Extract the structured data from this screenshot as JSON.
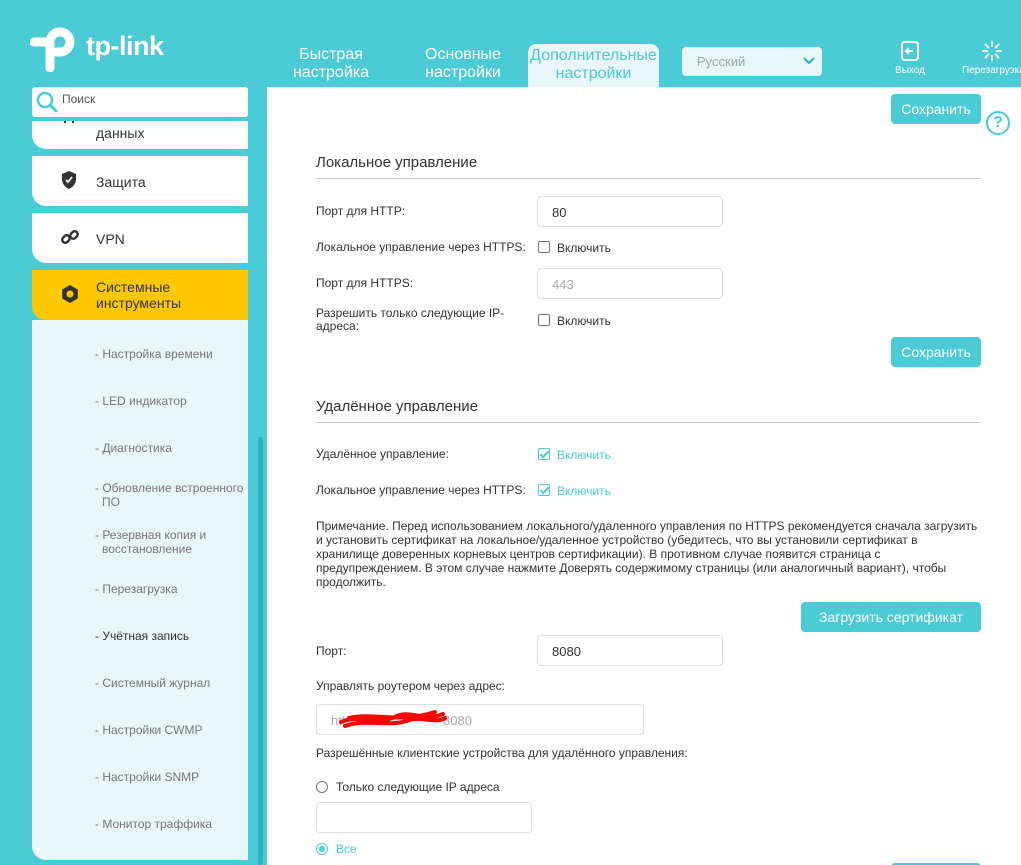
{
  "brand": {
    "name": "tp-link"
  },
  "tabs": [
    {
      "label_line1": "Быстрая",
      "label_line2": "настройка"
    },
    {
      "label_line1": "Основные",
      "label_line2": "настройки"
    },
    {
      "label_line1": "Дополнительные",
      "label_line2": "настройки"
    }
  ],
  "language": {
    "selected": "Русский"
  },
  "header_buttons": {
    "logout": "Выход",
    "reboot": "Перезагрузка"
  },
  "search": {
    "placeholder": "Поиск"
  },
  "sidebar": {
    "items": [
      {
        "label": "данных",
        "icon": "sort-arrows-icon"
      },
      {
        "label": "Защита",
        "icon": "shield-icon"
      },
      {
        "label": "VPN",
        "icon": "link-icon"
      },
      {
        "label_line1": "Системные",
        "label_line2": "инструменты",
        "icon": "gear-icon",
        "active": true
      }
    ],
    "subitems": [
      {
        "label": "- Настройка времени"
      },
      {
        "label": "- LED индикатор"
      },
      {
        "label": "- Диагностика"
      },
      {
        "label_line1": "- Обновление встроенного",
        "label_line2": "ПО"
      },
      {
        "label_line1": "- Резервная копия и",
        "label_line2": "восстановление"
      },
      {
        "label": "- Перезагрузка"
      },
      {
        "label": "- Учётная запись",
        "current": true
      },
      {
        "label": "- Системный журнал"
      },
      {
        "label": "- Настройки CWMP"
      },
      {
        "label": "- Настройки SNMP"
      },
      {
        "label": "- Монитор траффика"
      }
    ]
  },
  "main": {
    "save_label": "Сохранить",
    "local": {
      "title": "Локальное управление",
      "http_port_label": "Порт для HTTP:",
      "http_port_value": "80",
      "https_label": "Локальное управление через HTTPS:",
      "https_enable": "Включить",
      "https_enabled": false,
      "https_port_label": "Порт для HTTPS:",
      "https_port_value": "443",
      "allow_ip_label_line1": "Разрешить только следующие IP-",
      "allow_ip_label_line2": "адреса:",
      "allow_ip_enable": "Включить",
      "allow_ip_enabled": false
    },
    "remote": {
      "title": "Удалённое управление",
      "remote_label": "Удалённое управление:",
      "remote_enable": "Включить",
      "remote_enabled": true,
      "https_label": "Локальное управление через HTTPS:",
      "https_enable": "Включить",
      "https_enabled": true,
      "note": "Примечание. Перед использованием локального/удаленного управления по HTTPS рекомендуется сначала загрузить и установить сертификат на локальное/удаленное устройство (убедитесь, что вы установили сертификат в хранилище доверенных корневых центров сертификации). В противном случае появится страница с предупреждением. В этом случае нажмите Доверять содержимому страницы (или аналогичный вариант), чтобы продолжить.",
      "upload_cert": "Загрузить сертификат",
      "port_label": "Порт:",
      "port_value": "8080",
      "address_label": "Управлять роутером через адрес:",
      "address_prefix": "htt",
      "address_suffix": "8080",
      "clients_label": "Разрешённые клиентские устройства для удалённого управления:",
      "only_ip_label": "Только следующие IP адреса",
      "all_label": "Все",
      "selected_option": "all"
    }
  }
}
